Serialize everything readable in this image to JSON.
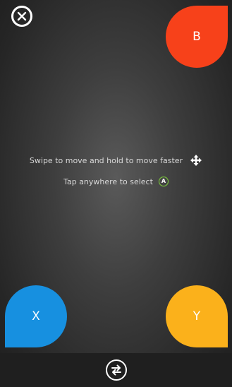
{
  "buttons": {
    "b_label": "B",
    "x_label": "X",
    "y_label": "Y",
    "b_color": "#f7411a",
    "x_color": "#1790e0",
    "y_color": "#fbb11b"
  },
  "instructions": {
    "swipe_text": "Swipe to move and hold to move faster",
    "tap_text": "Tap anywhere to select",
    "a_glyph": "A"
  },
  "icons": {
    "close": "close-icon",
    "move": "move-arrows-icon",
    "a_button": "a-button-icon",
    "switch": "switch-arrows-icon"
  },
  "colors": {
    "a_ring": "#7fd13b",
    "bottom_bar": "#1f1f1f"
  }
}
